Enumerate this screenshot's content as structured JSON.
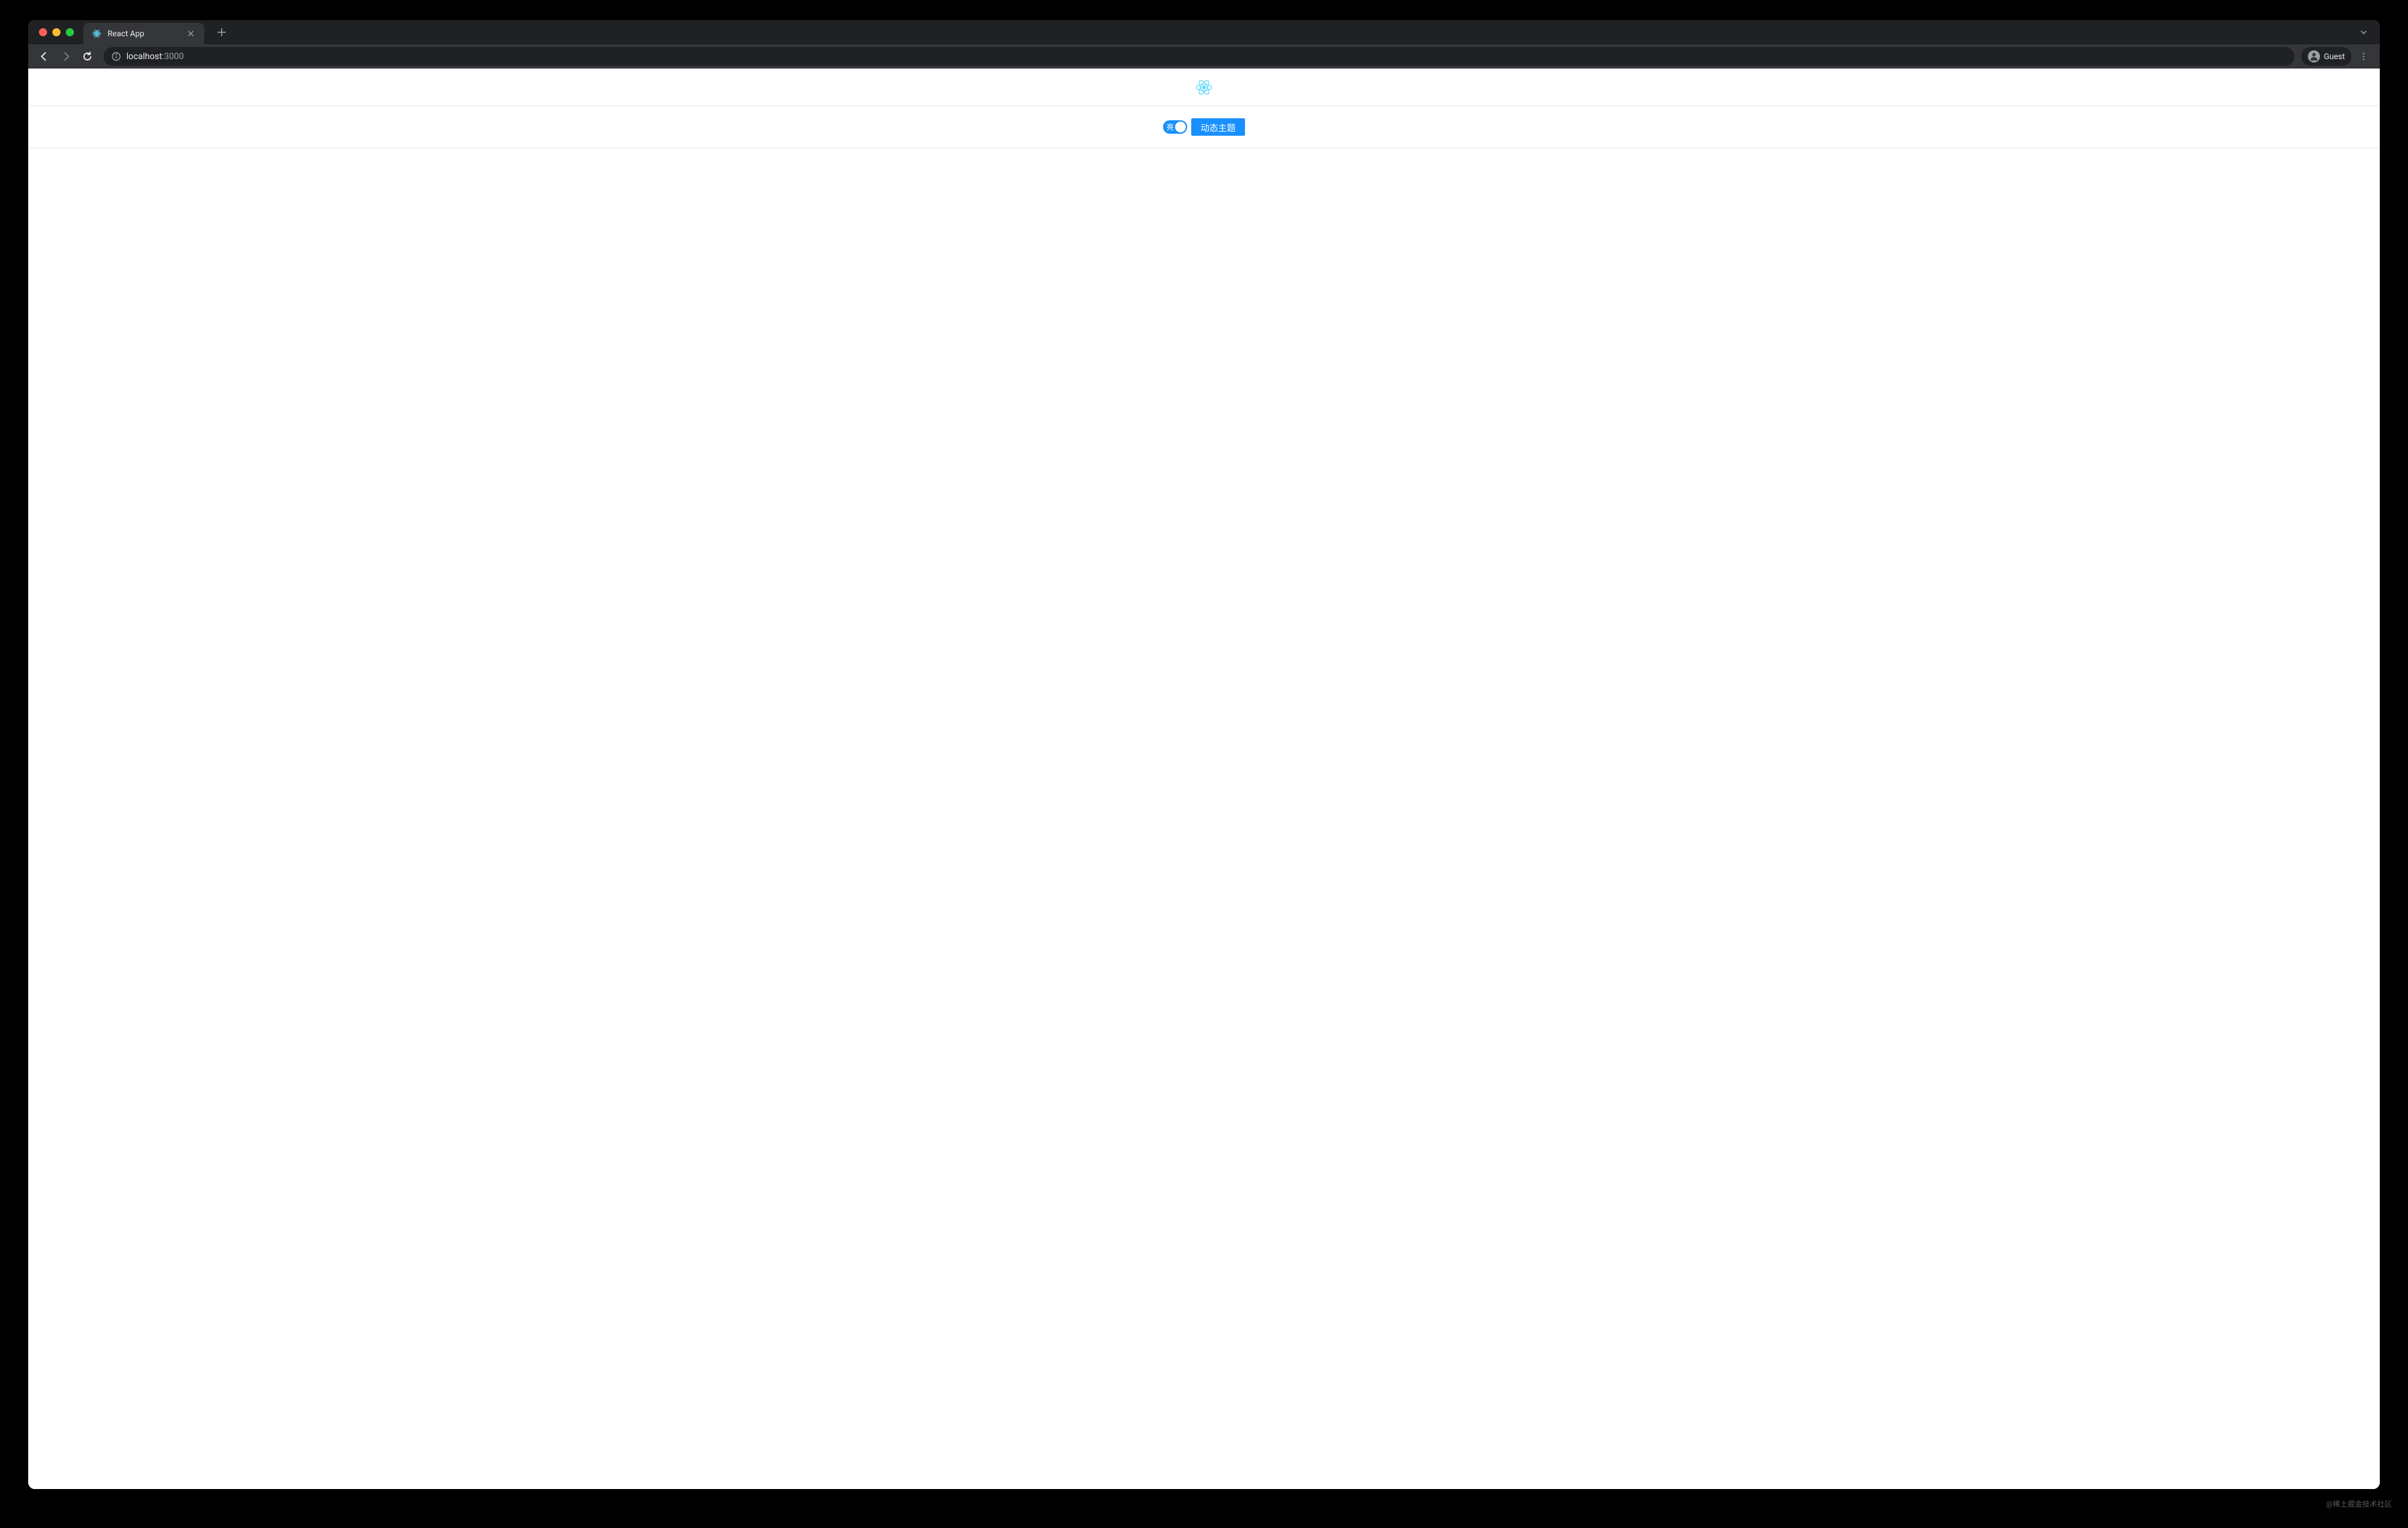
{
  "browser": {
    "tab": {
      "title": "React App"
    },
    "url": {
      "host": "localhost",
      "port": ":3000"
    },
    "profile": {
      "label": "Guest"
    }
  },
  "page": {
    "toggle": {
      "label": "亮",
      "checked": true
    },
    "button": {
      "label": "动态主题"
    }
  },
  "watermark": "@稀土掘金技术社区",
  "colors": {
    "primary": "#1890ff",
    "react_logo": "#61dafb"
  }
}
